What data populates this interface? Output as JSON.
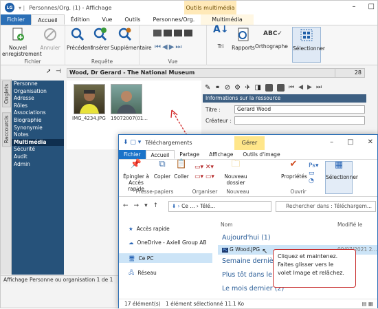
{
  "app": {
    "logo_text": "LG",
    "title": "Personnes/Org. (1) - Affichage",
    "context_tab": "Outils multimédia",
    "tabs": [
      "Fichier",
      "Accueil",
      "Édition",
      "Vue",
      "Outils",
      "Personnes/Org.",
      "Multimédia"
    ],
    "ribbon": {
      "fichier_group": {
        "label": "Fichier",
        "buttons": [
          "Nouvel enregistrement",
          "Annuler"
        ]
      },
      "requete_group": {
        "label": "Requête",
        "buttons": [
          "Précédent",
          "Insérer",
          "Supplémentaire"
        ]
      },
      "vue_group": {
        "label": "Vue"
      },
      "right_buttons": [
        "Tri",
        "Rapports",
        "Orthographe",
        "Sélectionner"
      ]
    },
    "record_header": "Wood, Dr Gerard - The National Museum",
    "record_count": "28",
    "side_tabs": [
      "Onglets",
      "Raccourcis"
    ],
    "nav_items": [
      "Personne",
      "Organisation",
      "Adresse",
      "Rôles",
      "Associations",
      "Biographie",
      "Synonymie",
      "Notes",
      "Multimédia",
      "Sécurité",
      "Audit",
      "Admin"
    ],
    "nav_selected": "Multimédia",
    "thumbnails": [
      {
        "caption": "IMG_4234.JPG"
      },
      {
        "caption": "19072007(01..."
      }
    ],
    "resource_header": "Informations sur la ressource",
    "fields": {
      "titre_label": "Titre :",
      "titre_value": "Gerard Wood",
      "createur_label": "Créateur :"
    },
    "status": {
      "left": "Affichage",
      "right": "Personne ou organisation 1 de 1"
    }
  },
  "explorer": {
    "title": "Téléchargements",
    "context_tab": "Gérer",
    "tabs": [
      "Fichier",
      "Accueil",
      "Partage",
      "Affichage",
      "Outils d'image"
    ],
    "ribbon": {
      "presse_papiers": {
        "label": "Presse-papiers",
        "buttons": [
          "Épingler à Accès rapide",
          "Copier",
          "Coller"
        ]
      },
      "organiser": {
        "label": "Organiser"
      },
      "nouveau": {
        "label": "Nouveau",
        "buttons": [
          "Nouveau dossier"
        ]
      },
      "ouvrir": {
        "label": "Ouvrir",
        "buttons": [
          "Propriétés"
        ]
      },
      "selectionner": {
        "buttons": [
          "Sélectionner"
        ]
      }
    },
    "address": [
      "Ce ...",
      "Télé..."
    ],
    "search_placeholder": "Rechercher dans : Téléchargem...",
    "sidebar": [
      "Accès rapide",
      "OneDrive - Axiell Group AB",
      "Ce PC",
      "Réseau"
    ],
    "sidebar_selected": "Ce PC",
    "columns": [
      "Nom",
      "Modifié le"
    ],
    "groups": [
      "Aujourd'hui (1)",
      "Semaine dernière",
      "Plus tôt dans le mois",
      "Le mois dernier (2)"
    ],
    "file": {
      "name": "G Wood.JPG",
      "date": "09/07/2021 2..."
    },
    "status_left": "17 élément(s)",
    "status_mid": "1 élément sélectionné  11.1 Ko"
  },
  "callout": {
    "line1": "Cliquez et maintenez.",
    "line2": "Faites glisser vers le",
    "line3": "volet Image et relâchez."
  },
  "colors": {
    "accent": "#2b6fb6",
    "nav": "#26527a",
    "callout_border": "#c62828",
    "context": "#ffe9b8"
  }
}
